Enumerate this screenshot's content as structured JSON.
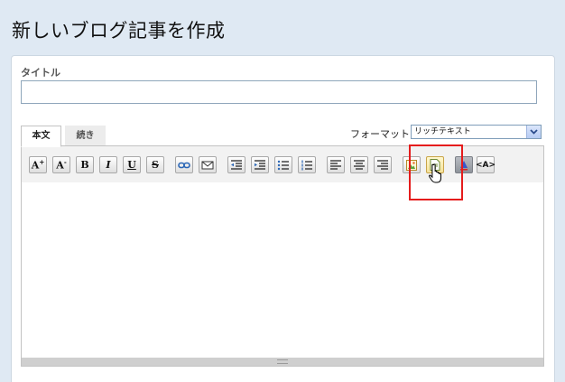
{
  "page": {
    "title": "新しいブログ記事を作成"
  },
  "form": {
    "title_label": "タイトル",
    "title_value": "",
    "tabs": [
      {
        "label": "本文",
        "active": true
      },
      {
        "label": "続き",
        "active": false
      }
    ],
    "format_label": "フォーマット:",
    "format_value": "リッチテキスト"
  },
  "toolbar": {
    "buttons": [
      {
        "name": "font-increase",
        "label": "A+"
      },
      {
        "name": "font-decrease",
        "label": "A-"
      },
      {
        "name": "bold",
        "label": "B"
      },
      {
        "name": "italic",
        "label": "I"
      },
      {
        "name": "underline",
        "label": "U"
      },
      {
        "name": "strikethrough",
        "label": "S"
      },
      {
        "name": "link",
        "icon": "link-icon"
      },
      {
        "name": "email-link",
        "icon": "envelope-icon"
      },
      {
        "name": "outdent",
        "icon": "outdent-icon"
      },
      {
        "name": "indent",
        "icon": "indent-icon"
      },
      {
        "name": "bullet-list",
        "icon": "bullet-list-icon"
      },
      {
        "name": "numbered-list",
        "icon": "numbered-list-icon"
      },
      {
        "name": "align-left",
        "icon": "align-left-icon"
      },
      {
        "name": "align-center",
        "icon": "align-center-icon"
      },
      {
        "name": "align-right",
        "icon": "align-right-icon"
      },
      {
        "name": "insert-image",
        "icon": "image-icon"
      },
      {
        "name": "insert-file",
        "icon": "file-icon",
        "highlighted": true
      },
      {
        "name": "text-color",
        "icon": "text-color-icon"
      },
      {
        "name": "html-mode",
        "label": "<A>"
      }
    ]
  },
  "colors": {
    "highlight": "#e51c1c",
    "background": "#dfe9f3",
    "input_border": "#8fa6bb"
  }
}
